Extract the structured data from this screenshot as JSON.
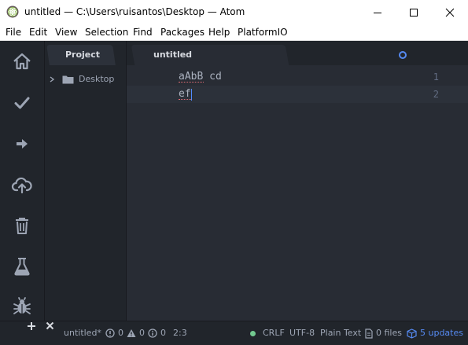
{
  "window": {
    "title": "untitled — C:\\Users\\ruisantos\\Desktop — Atom",
    "logo_icon": "atom-logo-icon",
    "controls": [
      "minimize-icon",
      "maximize-icon",
      "close-icon"
    ]
  },
  "menu": [
    "File",
    "Edit",
    "View",
    "Selection",
    "Find",
    "Packages",
    "Help",
    "PlatformIO"
  ],
  "toolbar": {
    "icons": [
      "home-icon",
      "check-icon",
      "arrow-right-icon",
      "cloud-upload-icon",
      "trash-icon",
      "flask-icon",
      "bug-icon"
    ]
  },
  "tree": {
    "tab_label": "Project",
    "items": [
      {
        "label": "Desktop",
        "icon": "folder-icon",
        "expanded": false
      }
    ]
  },
  "editor": {
    "tab_label": "untitled",
    "modified": true,
    "accent": "#568af2",
    "lines": [
      {
        "number": "1",
        "text": "aAbB cd"
      },
      {
        "number": "2",
        "text": "ef"
      }
    ]
  },
  "status": {
    "file": "untitled*",
    "errors": "0",
    "warnings": "0",
    "infos": "0",
    "cursor": "2:3",
    "line_ending": "CRLF",
    "encoding": "UTF-8",
    "grammar": "Plain Text",
    "files": "0 files",
    "updates": "5 updates",
    "updates_color": "#568af2",
    "ok_color": "#73c990"
  }
}
